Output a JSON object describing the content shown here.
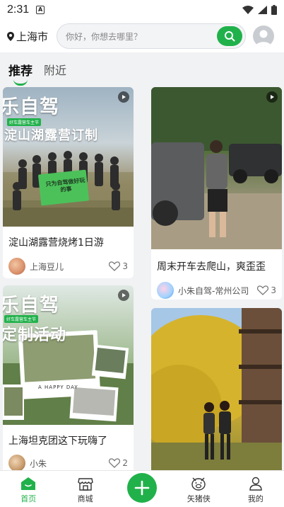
{
  "status_bar": {
    "time": "2:31",
    "notif_badge": "A"
  },
  "topbar": {
    "city": "上海市",
    "search_placeholder": "你好，你想去哪里？"
  },
  "tabs": [
    {
      "label": "推荐",
      "active": true
    },
    {
      "label": "附近",
      "active": false
    }
  ],
  "feed": {
    "cards": [
      {
        "title": "淀山湖露营烧烤1日游",
        "author": "上海豆儿",
        "likes": "3",
        "overlay_line1": "乐自驾",
        "overlay_line2": "淀山湖露营订制",
        "banner_tag": "好车露营车主节",
        "flag_text": "只为自驾做好玩的事",
        "has_video": true
      },
      {
        "title": "周末开车去爬山，爽歪歪",
        "author": "小朱自驾-常州公司",
        "likes": "3",
        "has_video": true
      },
      {
        "title": "上海坦克团这下玩嗨了",
        "author": "小朱",
        "likes": "2",
        "overlay_line1": "乐自驾",
        "overlay_line2": "定制活动",
        "banner_tag": "好车露营车主节",
        "photo_caption": "A  HAPPY  DAY",
        "has_video": true
      },
      {
        "title": "",
        "author": "",
        "likes": ""
      }
    ]
  },
  "bottom_nav": [
    {
      "label": "首页",
      "icon": "home-icon",
      "active": true
    },
    {
      "label": "商城",
      "icon": "shop-icon",
      "active": false
    },
    {
      "label": "",
      "icon": "plus-icon",
      "active": false
    },
    {
      "label": "矢猪侠",
      "icon": "pig-icon",
      "active": false
    },
    {
      "label": "我的",
      "icon": "user-icon",
      "active": false
    }
  ],
  "colors": {
    "accent": "#21b14b",
    "background": "#f1f2f4"
  }
}
